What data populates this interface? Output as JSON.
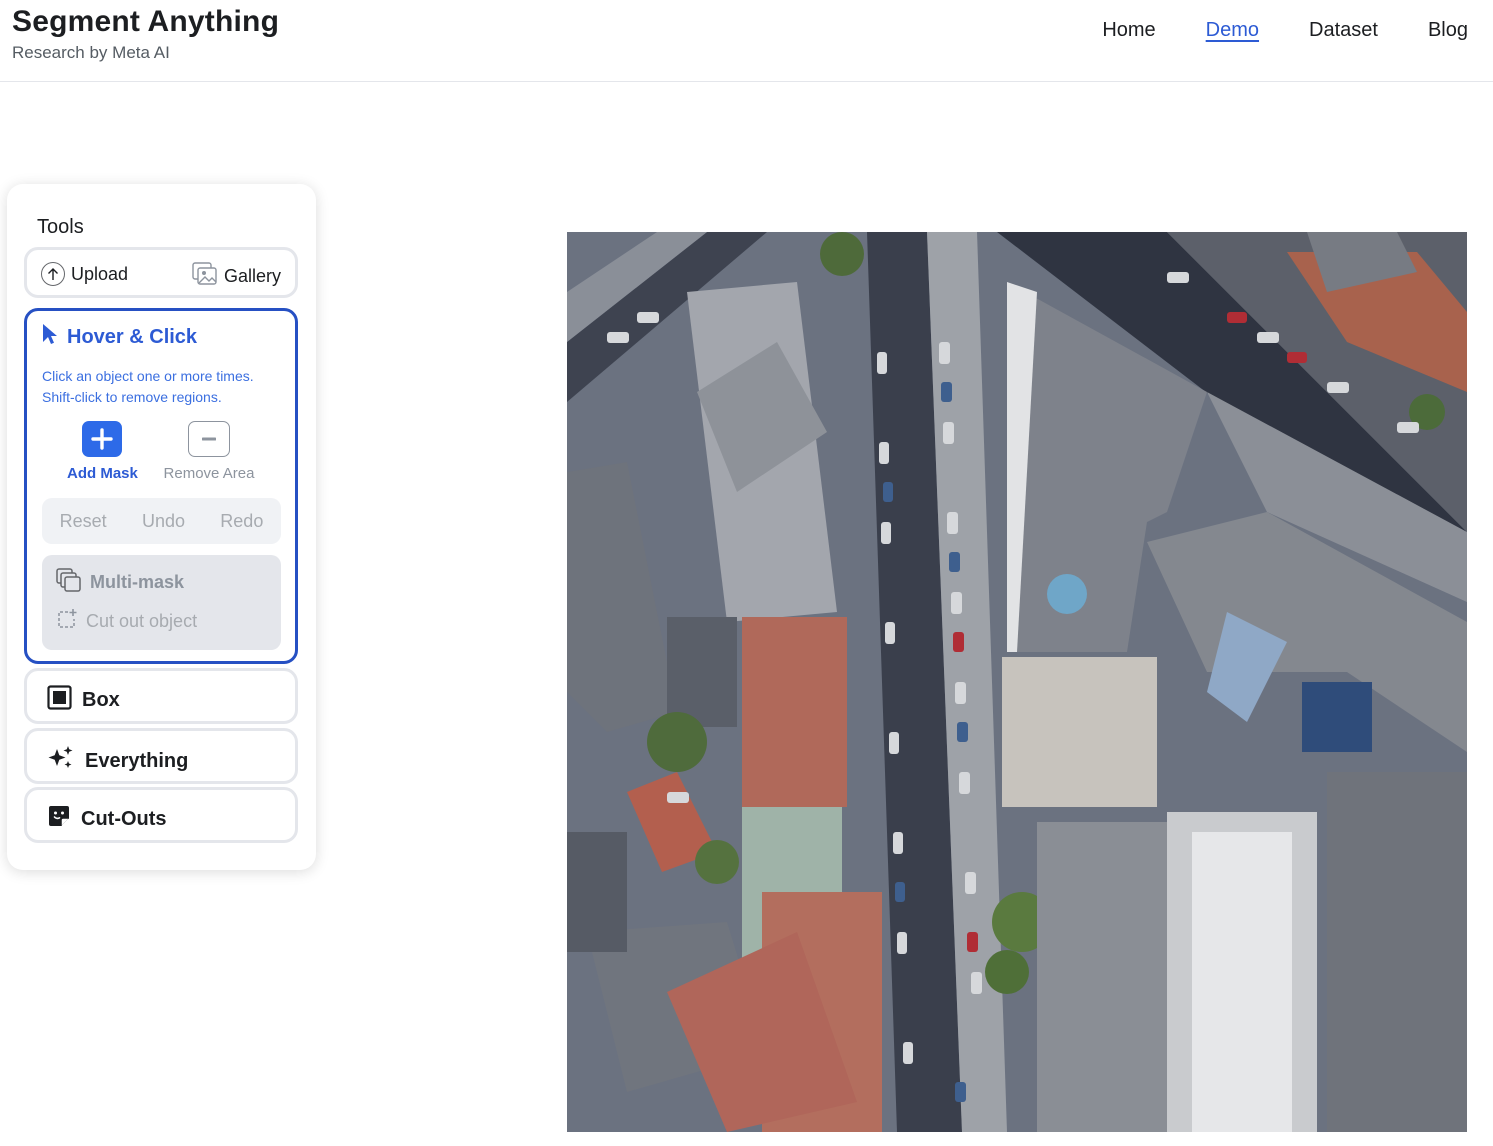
{
  "header": {
    "title": "Segment Anything",
    "subtitle": "Research by Meta AI",
    "nav": [
      "Home",
      "Demo",
      "Dataset",
      "Blog"
    ],
    "active_nav": "Demo"
  },
  "tools": {
    "heading": "Tools",
    "upload_label": "Upload",
    "gallery_label": "Gallery",
    "hover_click": {
      "title": "Hover & Click",
      "desc_line1": "Click an object one or more times.",
      "desc_line2": "Shift-click to remove regions.",
      "add_mask": "Add Mask",
      "remove_area": "Remove Area",
      "reset": "Reset",
      "undo": "Undo",
      "redo": "Redo",
      "multi_mask": "Multi-mask",
      "cut_out": "Cut out object"
    },
    "box": "Box",
    "everything": "Everything",
    "cut_outs": "Cut-Outs"
  },
  "colors": {
    "accent": "#2d5bd4",
    "add_mask_fill": "#2d6ae8",
    "active_border": "#2650c3"
  },
  "icons": {
    "upload": "arrow-up-circle-icon",
    "gallery": "image-gallery-icon",
    "hover_click": "cursor-pointer-icon",
    "add": "plus-icon",
    "remove": "minus-icon",
    "multi_mask": "layers-icon",
    "cut_out": "crop-add-icon",
    "box": "square-icon",
    "everything": "sparkles-icon",
    "cut_outs": "sticker-icon"
  }
}
